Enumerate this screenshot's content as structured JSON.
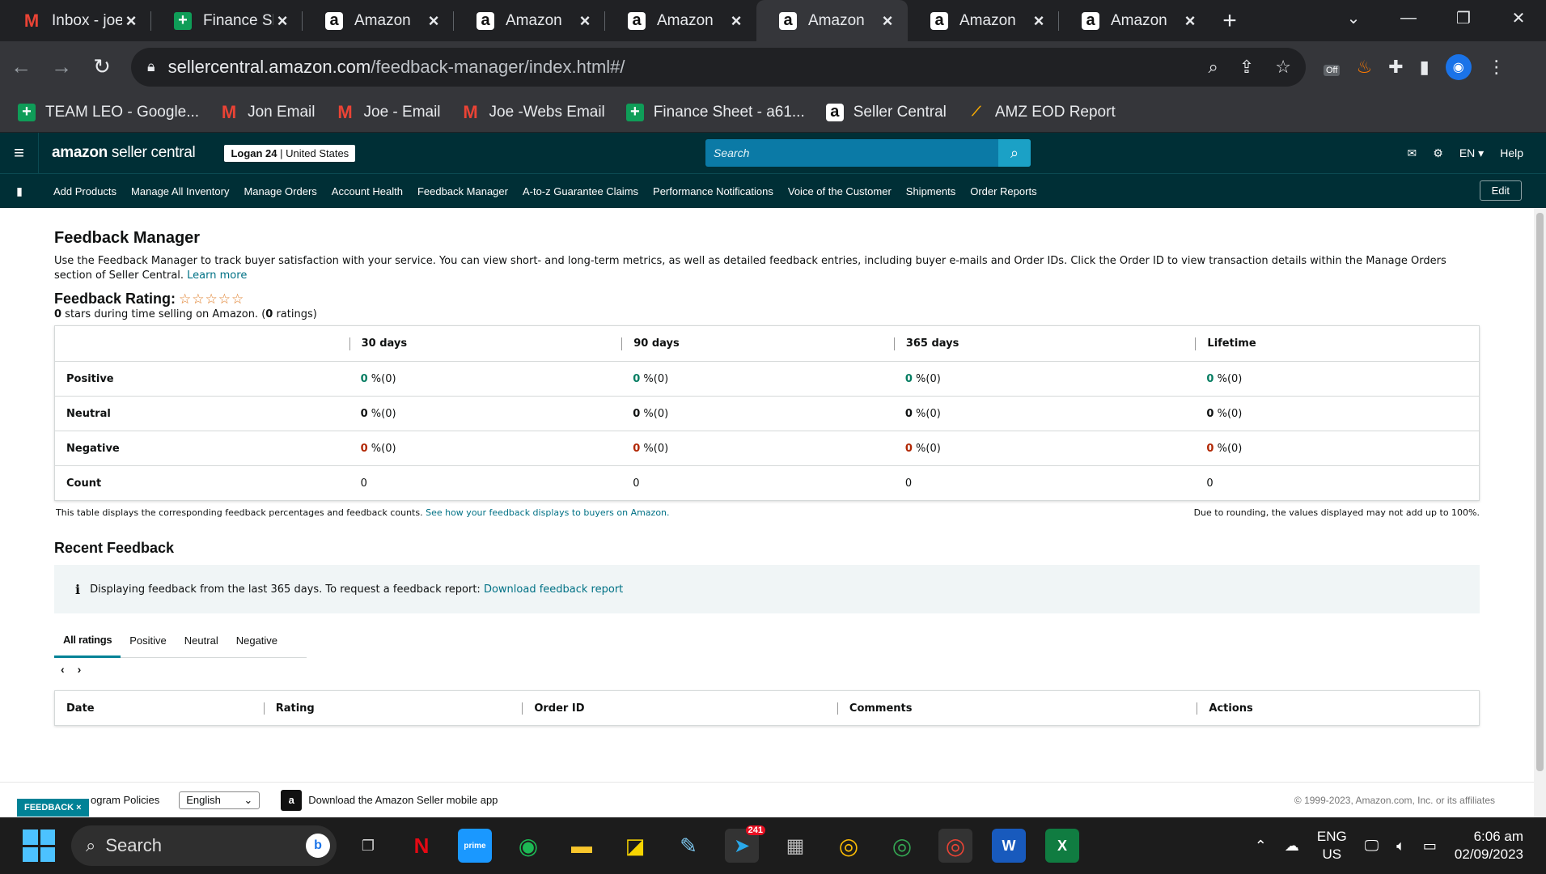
{
  "browser": {
    "tabs": [
      {
        "title": "Inbox - joer",
        "favicon": "gmail-icon",
        "active": false
      },
      {
        "title": "Finance She",
        "favicon": "sheets-icon",
        "active": false
      },
      {
        "title": "Amazon",
        "favicon": "amazon-icon",
        "active": false
      },
      {
        "title": "Amazon",
        "favicon": "amazon-icon",
        "active": false
      },
      {
        "title": "Amazon",
        "favicon": "amazon-icon",
        "active": false
      },
      {
        "title": "Amazon",
        "favicon": "amazon-icon",
        "active": true
      },
      {
        "title": "Amazon",
        "favicon": "amazon-icon",
        "active": false
      },
      {
        "title": "Amazon",
        "favicon": "amazon-icon",
        "active": false
      }
    ],
    "url_host": "sellercentral.amazon.com",
    "url_path": "/feedback-manager/index.html#/",
    "extension_off_label": "Off",
    "bookmarks": [
      {
        "label": "TEAM LEO - Google...",
        "icon": "sheets-icon"
      },
      {
        "label": "Jon Email",
        "icon": "gmail-icon"
      },
      {
        "label": "Joe - Email",
        "icon": "gmail-icon"
      },
      {
        "label": "Joe -Webs Email",
        "icon": "gmail-icon"
      },
      {
        "label": "Finance Sheet - a61...",
        "icon": "sheets-icon"
      },
      {
        "label": "Seller Central",
        "icon": "amazon-icon"
      },
      {
        "label": "AMZ EOD Report",
        "icon": "report-icon"
      }
    ]
  },
  "seller_central": {
    "logo_bold": "amazon",
    "logo_rest": " seller central",
    "store_name": "Logan 24",
    "store_region": " | United States",
    "search_placeholder": "Search",
    "language": "EN",
    "help_label": "Help",
    "nav": [
      "Add Products",
      "Manage All Inventory",
      "Manage Orders",
      "Account Health",
      "Feedback Manager",
      "A-to-z Guarantee Claims",
      "Performance Notifications",
      "Voice of the Customer",
      "Shipments",
      "Order Reports"
    ],
    "edit_label": "Edit"
  },
  "page": {
    "title": "Feedback Manager",
    "intro": "Use the Feedback Manager to track buyer satisfaction with your service. You can view short- and long-term metrics, as well as detailed feedback entries, including buyer e-mails and Order IDs. Click the Order ID to view transaction details within the Manage Orders section of Seller Central.",
    "learn_more": "Learn more",
    "rating_label": "Feedback Rating:",
    "stars": "☆☆☆☆☆",
    "rating_stars_count": "0",
    "rating_sub_mid": " stars during time selling on Amazon. (",
    "rating_count": "0",
    "rating_sub_end": " ratings)",
    "table": {
      "headers": [
        "30 days",
        "90 days",
        "365 days",
        "Lifetime"
      ],
      "rows": [
        {
          "label": "Positive",
          "values": [
            {
              "n": "0",
              "rest": " %(0)"
            },
            {
              "n": "0",
              "rest": " %(0)"
            },
            {
              "n": "0",
              "rest": " %(0)"
            },
            {
              "n": "0",
              "rest": " %(0)"
            }
          ]
        },
        {
          "label": "Neutral",
          "values": [
            {
              "n": "0",
              "rest": " %(0)"
            },
            {
              "n": "0",
              "rest": " %(0)"
            },
            {
              "n": "0",
              "rest": " %(0)"
            },
            {
              "n": "0",
              "rest": " %(0)"
            }
          ]
        },
        {
          "label": "Negative",
          "values": [
            {
              "n": "0",
              "rest": " %(0)"
            },
            {
              "n": "0",
              "rest": " %(0)"
            },
            {
              "n": "0",
              "rest": " %(0)"
            },
            {
              "n": "0",
              "rest": " %(0)"
            }
          ]
        },
        {
          "label": "Count",
          "values": [
            {
              "n": "",
              "rest": "0"
            },
            {
              "n": "",
              "rest": "0"
            },
            {
              "n": "",
              "rest": "0"
            },
            {
              "n": "",
              "rest": "0"
            }
          ]
        }
      ],
      "note": "This table displays the corresponding feedback percentages and feedback counts.",
      "note_link": "See how your feedback displays to buyers on Amazon.",
      "rounding_note": "Due to rounding, the values displayed may not add up to 100%."
    },
    "recent_title": "Recent Feedback",
    "info_text": "Displaying feedback from the last 365 days. To request a feedback report:",
    "info_link": "Download feedback report",
    "filter_tabs": [
      "All ratings",
      "Positive",
      "Neutral",
      "Negative"
    ],
    "list_columns": [
      "Date",
      "Rating",
      "Order ID",
      "Comments",
      "Actions"
    ]
  },
  "footer": {
    "feedback_tab": "FEEDBACK",
    "policies": "ogram Policies",
    "language": "English",
    "app_link": "Download the Amazon Seller mobile app",
    "copyright": "© 1999-2023, Amazon.com, Inc. or its affiliates"
  },
  "taskbar": {
    "search_label": "Search",
    "telegram_badge": "241",
    "lang_top": "ENG",
    "lang_bottom": "US",
    "time": "6:06 am",
    "date": "02/09/2023"
  }
}
